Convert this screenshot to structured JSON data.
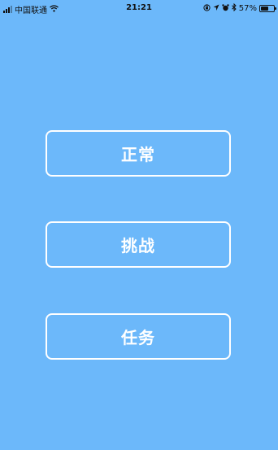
{
  "status_bar": {
    "carrier": "中国联通",
    "time": "21:21",
    "battery_percent_label": "57%",
    "battery_level": 0.57,
    "icons": [
      "signal-icon",
      "wifi-icon",
      "lock-rotation-icon",
      "location-icon",
      "alarm-icon",
      "bluetooth-icon",
      "battery-icon"
    ]
  },
  "menu": {
    "normal_label": "正常",
    "challenge_label": "挑战",
    "task_label": "任务"
  },
  "colors": {
    "background": "#6cb8fa",
    "button_border": "#ffffff",
    "button_text": "#ffffff"
  }
}
